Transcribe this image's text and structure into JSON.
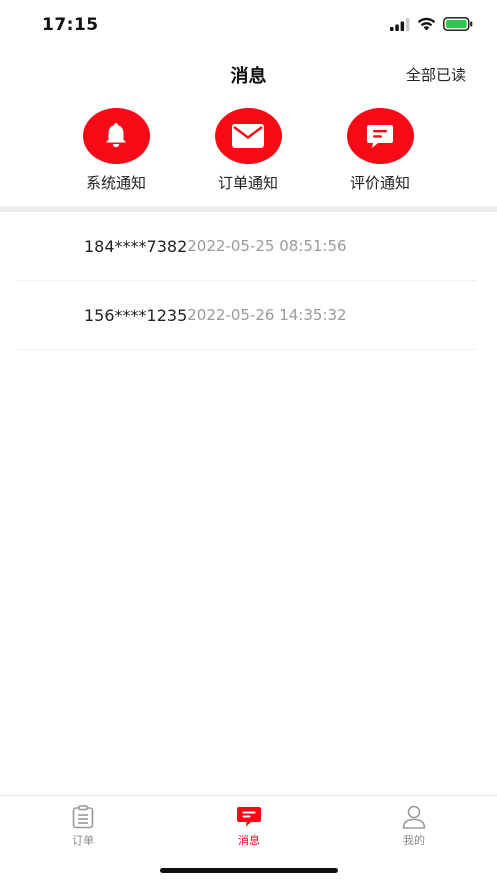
{
  "status_bar": {
    "time": "17:15",
    "icons": [
      "signal-icon",
      "wifi-icon",
      "battery-icon"
    ]
  },
  "header": {
    "title": "消息",
    "action_label": "全部已读"
  },
  "categories": [
    {
      "label": "系统通知",
      "icon": "bell-icon"
    },
    {
      "label": "订单通知",
      "icon": "envelope-icon"
    },
    {
      "label": "评价通知",
      "icon": "comment-icon"
    }
  ],
  "messages": [
    {
      "phone": "184****7382",
      "time": "2022-05-25 08:51:56"
    },
    {
      "phone": "156****1235",
      "time": "2022-05-26 14:35:32"
    }
  ],
  "tab_bar": {
    "tabs": [
      {
        "label": "订单",
        "icon": "clipboard-icon",
        "active": false
      },
      {
        "label": "消息",
        "icon": "message-icon",
        "active": true
      },
      {
        "label": "我的",
        "icon": "user-icon",
        "active": false
      }
    ]
  },
  "colors": {
    "accent": "#f50a16",
    "text": "#222222",
    "muted": "#9a9a9a",
    "divider": "#ececec"
  }
}
